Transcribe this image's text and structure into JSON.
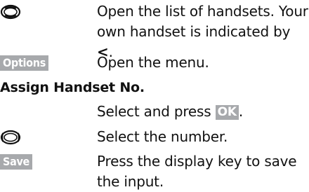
{
  "entries": [
    {
      "icon": "control-key-up-down-icon",
      "text": "Open the list of handsets. Your own handset is indicated by ",
      "marker": "<",
      "suffix": "."
    },
    {
      "key": "Options",
      "text": "Open the menu."
    },
    {
      "heading": "Assign Handset No."
    },
    {
      "text_before": "Select and press ",
      "key_inline": "OK",
      "text_after": "."
    },
    {
      "icon": "control-key-left-right-icon",
      "text": "Select the number."
    },
    {
      "key": "Save",
      "text": "Press the display key to save the input."
    }
  ]
}
